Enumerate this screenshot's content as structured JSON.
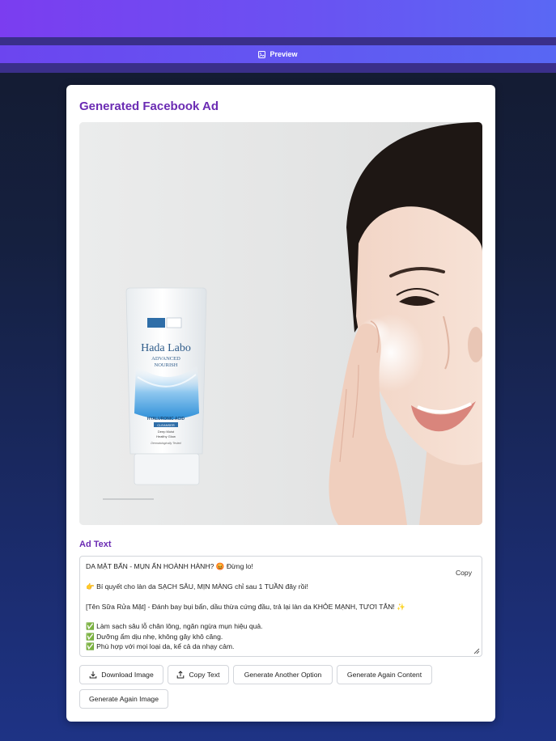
{
  "header": {
    "preview_label": "Preview"
  },
  "card": {
    "title": "Generated Facebook Ad",
    "image_alt": "Hada Labo Advanced Nourish cleanser ad with woman washing face",
    "product_brand": "Hada Labo",
    "product_line1": "ADVANCED",
    "product_line2": "NOURISH",
    "product_ingredient": "HYALURONIC ACID",
    "product_type": "CLEANSER",
    "product_desc1": "Deep Moist",
    "product_desc2": "Healthy Glow",
    "product_claim": "Dermatologically Tested",
    "ad_text_label": "Ad Text",
    "ad_text_lines": [
      "DA MẶT BẨN - MỤN ẨN HOÀNH HÀNH? 😡 Đừng lo!",
      "",
      "👉 Bí quyết cho làn da SẠCH SÂU, MỊN MÀNG chỉ sau 1 TUẦN đây rồi!",
      "",
      "[Tên Sữa Rửa Mặt] - Đánh bay bụi bẩn, dầu thừa cứng đầu, trả lại làn da KHỎE MẠNH, TƯƠI TẮN! ✨",
      "",
      "✅ Làm sạch sâu lỗ chân lông, ngăn ngừa mụn hiệu quả.",
      "✅ Dưỡng ẩm dịu nhẹ, không gây khô căng.",
      "✅ Phù hợp với mọi loại da, kể cả da nhạy cảm."
    ],
    "copy_inline": "Copy"
  },
  "actions": {
    "download_image": "Download Image",
    "copy_text": "Copy Text",
    "generate_another_option": "Generate Another Option",
    "generate_again_content": "Generate Again Content",
    "generate_again_image": "Generate Again Image"
  },
  "colors": {
    "accent": "#6b2bb3",
    "header_gradient_start": "#7b3df0",
    "header_gradient_end": "#5a68f4"
  }
}
